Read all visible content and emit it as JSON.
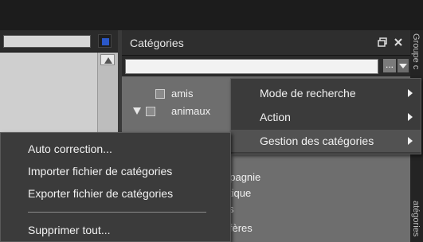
{
  "left_pane": {},
  "categories": {
    "title": "Catégories",
    "more_button": "...",
    "rows": [
      {
        "label": "amis",
        "checked": false,
        "expandable": false
      },
      {
        "label": "animaux",
        "checked": false,
        "expandable": true,
        "expanded": true
      },
      {
        "label": "",
        "checked": false
      },
      {
        "label": "",
        "checked": false
      },
      {
        "label": "",
        "checked": false
      },
      {
        "label": "npagnie",
        "checked": false
      },
      {
        "label": "tique",
        "checked": false
      },
      {
        "label": "s",
        "checked": false
      },
      {
        "label": "ifères",
        "checked": false
      }
    ]
  },
  "right_tab": {
    "top_label": "Groupe c",
    "bottom_label": "atégories"
  },
  "context_menu": {
    "items": [
      {
        "label": "Mode de recherche",
        "has_submenu": true
      },
      {
        "label": "Action",
        "has_submenu": true
      },
      {
        "label": "Gestion des catégories",
        "has_submenu": true,
        "selected": true
      }
    ]
  },
  "submenu": {
    "items": [
      {
        "label": "Auto correction..."
      },
      {
        "label": "Importer fichier de catégories"
      },
      {
        "label": "Exporter fichier de catégories"
      },
      {
        "label": "Supprimer tout..."
      }
    ]
  },
  "colors": {
    "accent": "#2a57c8",
    "menu_bg": "#3b3b3b",
    "panel_bg": "#6e6e6e"
  }
}
